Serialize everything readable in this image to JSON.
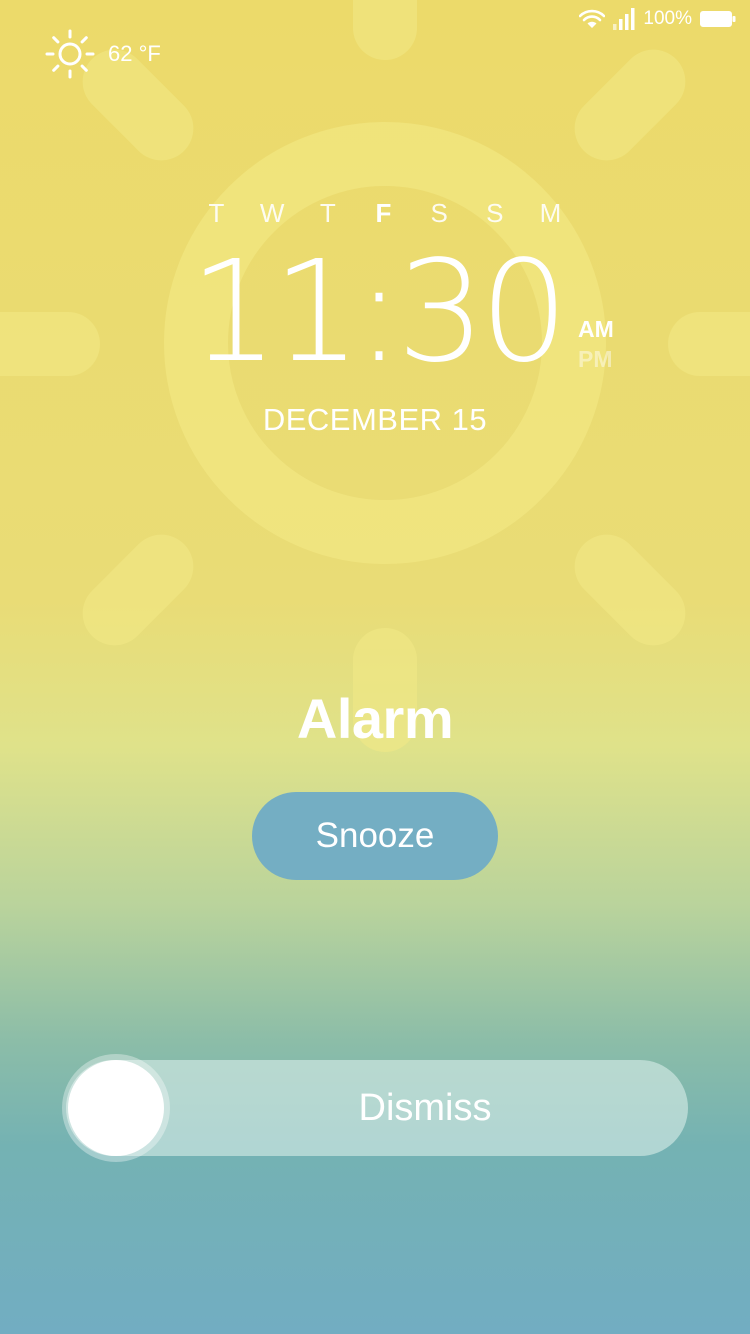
{
  "status_bar": {
    "battery_percent": "100%",
    "battery_level": 1.0,
    "icons": [
      "wifi-icon",
      "signal-icon",
      "battery-icon"
    ]
  },
  "weather": {
    "icon": "sun-icon",
    "temperature": "62 °F"
  },
  "clock": {
    "weekdays": [
      {
        "label": "T",
        "active": false
      },
      {
        "label": "W",
        "active": false
      },
      {
        "label": "T",
        "active": false
      },
      {
        "label": "F",
        "active": true
      },
      {
        "label": "S",
        "active": false
      },
      {
        "label": "S",
        "active": false
      },
      {
        "label": "M",
        "active": false
      }
    ],
    "time": "11:30",
    "am_label": "AM",
    "pm_label": "PM",
    "selected_period": "AM",
    "date": "DECEMBER 15"
  },
  "alarm": {
    "title": "Alarm",
    "snooze_label": "Snooze",
    "dismiss_label": "Dismiss"
  },
  "colors": {
    "background_top": "#ecda6a",
    "background_bottom": "#72adc2",
    "snooze_button": "#74aec3",
    "sun_decoration": "#f1e67e"
  }
}
